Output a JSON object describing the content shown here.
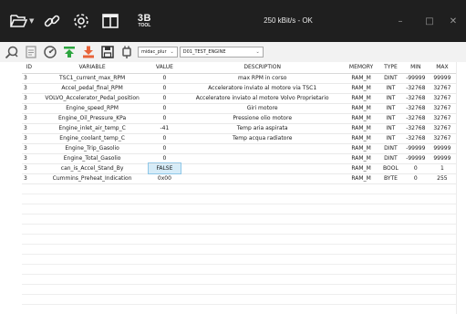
{
  "window": {
    "title": "250 kBit/s - OK",
    "minimize_glyph": "–",
    "maximize_glyph": "□",
    "close_glyph": "✕"
  },
  "titlebar_icons": [
    "folder-open-icon",
    "link-icon",
    "gear-icon",
    "panels-icon",
    "3b-tool-icon"
  ],
  "tool_logo": {
    "big": "3B",
    "small": "TOOL"
  },
  "toolbar": {
    "icons": [
      "search-icon",
      "document-icon",
      "gauge-icon",
      "upload-icon",
      "download-icon",
      "save-icon",
      "plug-icon"
    ],
    "device_select": "midac_plur",
    "engine_select": "D01_TEST_ENGINE"
  },
  "colors": {
    "titlebar_bg": "#1f1f1f",
    "toolbar_bg": "#f2f2f2",
    "upload_green": "#2ca53f",
    "download_orange": "#e8643a",
    "edit_cell": "#d6ecf8"
  },
  "table": {
    "columns": [
      "ID",
      "VARIABLE",
      "VALUE",
      "DESCRIPTION",
      "MEMORY",
      "TYPE",
      "MIN",
      "MAX"
    ],
    "rows": [
      [
        "3",
        "TSC1_current_max_RPM",
        "0",
        "max RPM in corso",
        "RAM_M",
        "DINT",
        "-99999",
        "99999"
      ],
      [
        "3",
        "Accel_pedal_final_RPM",
        "0",
        "Acceleratore inviato al motore via TSC1",
        "RAM_M",
        "INT",
        "-32768",
        "32767"
      ],
      [
        "3",
        "VOLVO_Accelerator_Pedal_position",
        "0",
        "Acceleratore inviato al motore Volvo Proprietario",
        "RAM_M",
        "INT",
        "-32768",
        "32767"
      ],
      [
        "3",
        "Engine_speed_RPM",
        "0",
        "Giri motore",
        "RAM_M",
        "INT",
        "-32768",
        "32767"
      ],
      [
        "3",
        "Engine_Oil_Pressure_KPa",
        "0",
        "Pressione olio motore",
        "RAM_M",
        "INT",
        "-32768",
        "32767"
      ],
      [
        "3",
        "Engine_inlet_air_temp_C",
        "-41",
        "Temp aria aspirata",
        "RAM_M",
        "INT",
        "-32768",
        "32767"
      ],
      [
        "3",
        "Engine_coolant_temp_C",
        "0",
        "Temp acqua radiatore",
        "RAM_M",
        "INT",
        "-32768",
        "32767"
      ],
      [
        "3",
        "Engine_Trip_Gasolio",
        "0",
        "",
        "RAM_M",
        "DINT",
        "-99999",
        "99999"
      ],
      [
        "3",
        "Engine_Total_Gasolio",
        "0",
        "",
        "RAM_M",
        "DINT",
        "-99999",
        "99999"
      ],
      [
        "3",
        "can_is_Accel_Stand_By",
        "FALSE",
        "",
        "RAM_M",
        "BOOL",
        "0",
        "1"
      ],
      [
        "3",
        "Cummins_Preheat_Indication",
        "0x00",
        "",
        "RAM_M",
        "BYTE",
        "0",
        "255"
      ]
    ],
    "editing_row": 9
  }
}
